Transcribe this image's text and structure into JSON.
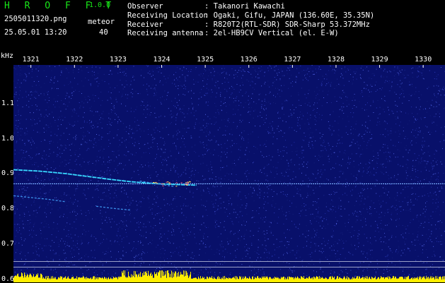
{
  "header": {
    "app_title": "H R O F F T",
    "app_version": "1.0.0",
    "filename": "2505011320.png",
    "datetime": "25.05.01 13:20",
    "meteor_label": "meteor",
    "meteor_count": "40",
    "info": [
      {
        "label": "Observer",
        "value": ": Takanori Kawachi"
      },
      {
        "label": "Receiving Location",
        "value": ": Ogaki, Gifu, JAPAN (136.60E, 35.35N)"
      },
      {
        "label": "Receiver",
        "value": ": R820T2(RTL-SDR) SDR-Sharp 53.372MHz"
      },
      {
        "label": "Receiving antenna",
        "value": ": 2el-HB9CV Vertical (el. E-W)"
      }
    ]
  },
  "colors": {
    "title_green": "#19e619",
    "background": "#08106a",
    "trace_cyan": "#38d8ff",
    "trace_yellow": "#ffee00"
  },
  "chart_data": {
    "type": "heatmap",
    "ylabel": "kHz",
    "x_ticks": [
      "1321",
      "1322",
      "1323",
      "1324",
      "1325",
      "1326",
      "1327",
      "1328",
      "1329",
      "1330"
    ],
    "y_ticks": [
      "1.1",
      "1.0",
      "0.9",
      "0.8",
      "0.7",
      "0.6"
    ],
    "xlim": [
      1320.6,
      1330.5
    ],
    "ylim": [
      0.592,
      1.21
    ],
    "reference_line_khz": 0.872,
    "meteor_traces": [
      {
        "points": [
          [
            1320.6,
            0.912
          ],
          [
            1321.2,
            0.908
          ],
          [
            1321.8,
            0.901
          ],
          [
            1322.3,
            0.893
          ],
          [
            1322.8,
            0.885
          ],
          [
            1323.3,
            0.878
          ],
          [
            1323.8,
            0.873
          ],
          [
            1324.3,
            0.87
          ],
          [
            1324.8,
            0.868
          ]
        ]
      },
      {
        "points": [
          [
            1320.6,
            0.838
          ],
          [
            1321.0,
            0.833
          ],
          [
            1321.4,
            0.828
          ],
          [
            1321.8,
            0.821
          ]
        ]
      },
      {
        "points": [
          [
            1322.5,
            0.808
          ],
          [
            1322.9,
            0.802
          ],
          [
            1323.3,
            0.797
          ]
        ]
      },
      {
        "points": [
          [
            1323.5,
            0.88
          ],
          [
            1323.9,
            0.872
          ],
          [
            1324.3,
            0.864
          ]
        ]
      }
    ]
  }
}
